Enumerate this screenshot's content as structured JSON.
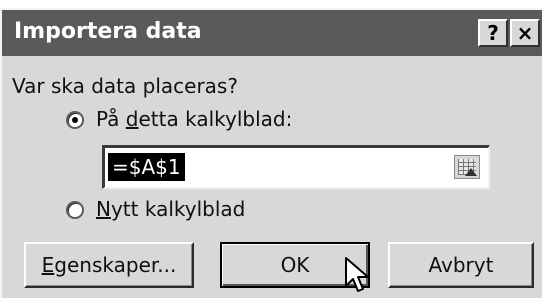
{
  "dialog": {
    "title": "Importera data",
    "help_label": "?",
    "close_label": "×"
  },
  "question": "Var ska data placeras?",
  "options": [
    {
      "label": "På detta kalkylblad:",
      "mnemonic": "d",
      "selected": true
    },
    {
      "label": "Nytt kalkylblad",
      "mnemonic": "N",
      "selected": false
    }
  ],
  "range_field": {
    "value": "=$A$1",
    "icon": "collapse-dialog-icon"
  },
  "buttons": {
    "properties": "Egenskaper...",
    "ok": "OK",
    "cancel": "Avbryt"
  },
  "cursor_icon": "arrow-pointer-icon",
  "colors": {
    "titlebar": "#5a5a5a",
    "dialog_bg": "#d8d8d8",
    "selection": "#000000"
  }
}
